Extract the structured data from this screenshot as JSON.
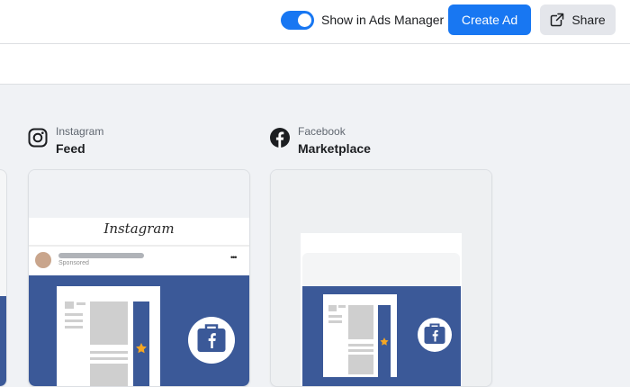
{
  "header": {
    "toggle_label": "Show in Ads Manager",
    "toggle_on": true,
    "create_ad_label": "Create Ad",
    "share_label": "Share"
  },
  "placements": [
    {
      "platform": "Instagram",
      "position": "Feed",
      "icon": "instagram-icon"
    },
    {
      "platform": "Facebook",
      "position": "Marketplace",
      "icon": "facebook-icon"
    }
  ],
  "instagram_preview": {
    "logo_text": "Instagram",
    "sponsored": "Sponsored",
    "more": "•••"
  },
  "colors": {
    "accent": "#1877f2",
    "ad_blue": "#3b5998",
    "star": "#f5a623"
  }
}
